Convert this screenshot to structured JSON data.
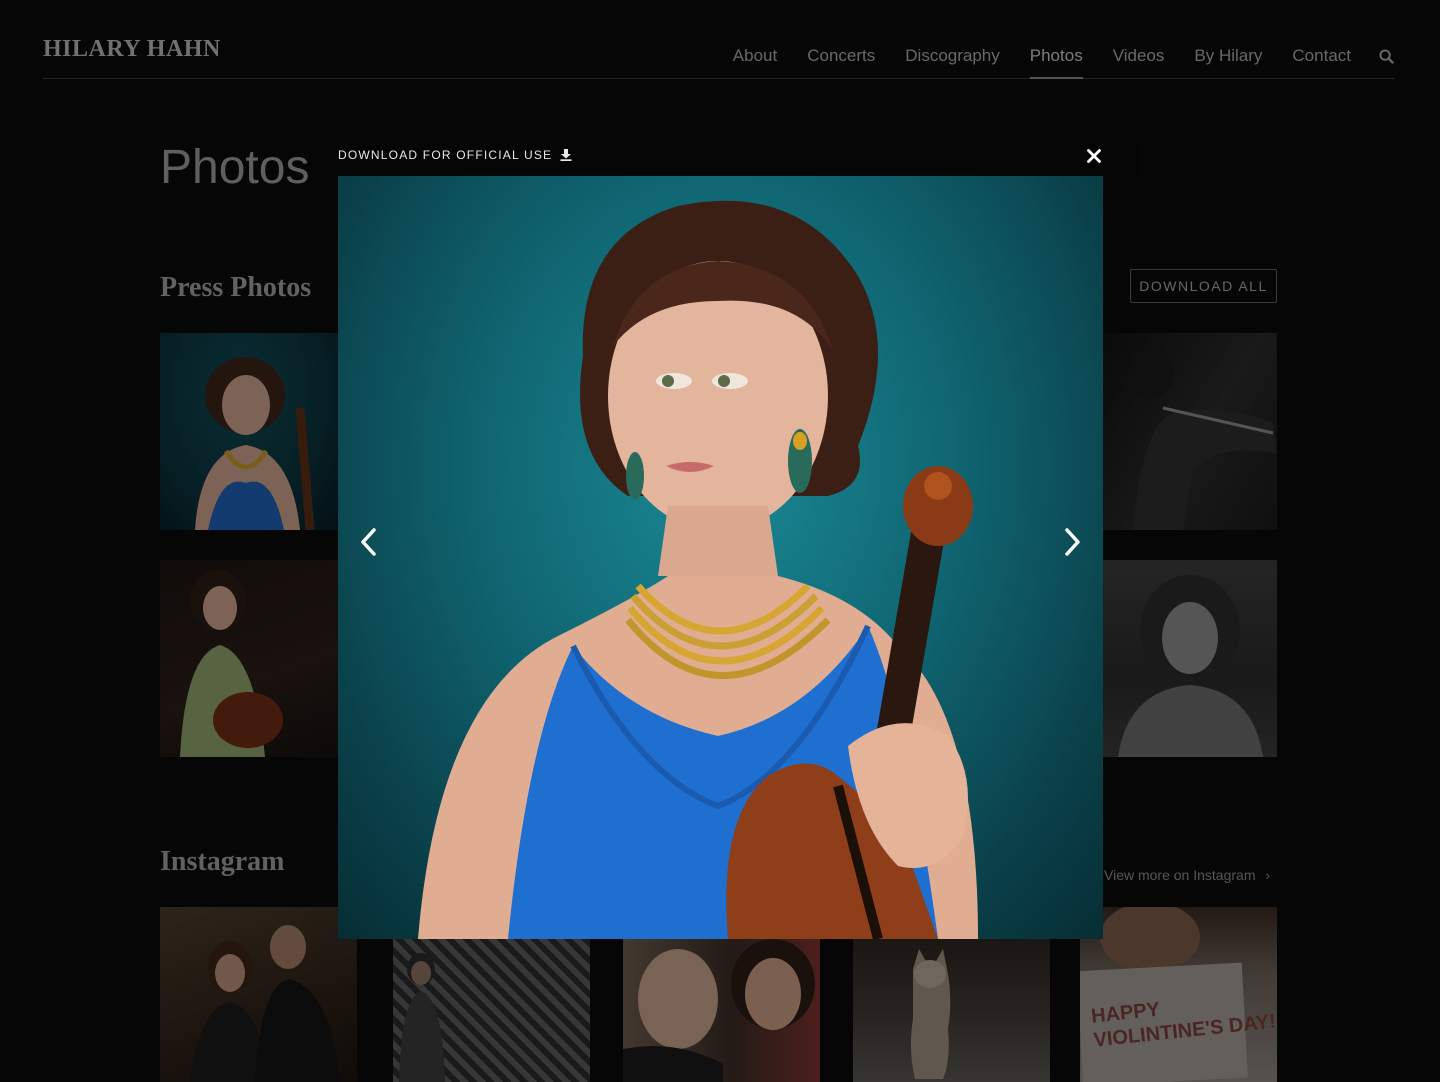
{
  "header": {
    "logo": "HILARY HAHN",
    "nav": [
      {
        "label": "About",
        "active": false
      },
      {
        "label": "Concerts",
        "active": false
      },
      {
        "label": "Discography",
        "active": false
      },
      {
        "label": "Photos",
        "active": true
      },
      {
        "label": "Videos",
        "active": false
      },
      {
        "label": "By Hilary",
        "active": false
      },
      {
        "label": "Contact",
        "active": false
      }
    ],
    "search_icon": "search-icon"
  },
  "page": {
    "title": "Photos",
    "press_section": {
      "title": "Press Photos",
      "download_all_label": "DOWNLOAD ALL"
    },
    "instagram_section": {
      "title": "Instagram",
      "view_more_label": "View more on Instagram",
      "view_more_icon": "chevron-right-icon",
      "card_text": "HAPPY VIOLINTINE'S DAY!"
    }
  },
  "lightbox": {
    "download_label": "DOWNLOAD FOR OFFICIAL USE",
    "download_icon": "download-icon",
    "close_icon": "close-icon",
    "prev_icon": "chevron-left-icon",
    "next_icon": "chevron-right-icon",
    "image_background": "#0f6470"
  }
}
